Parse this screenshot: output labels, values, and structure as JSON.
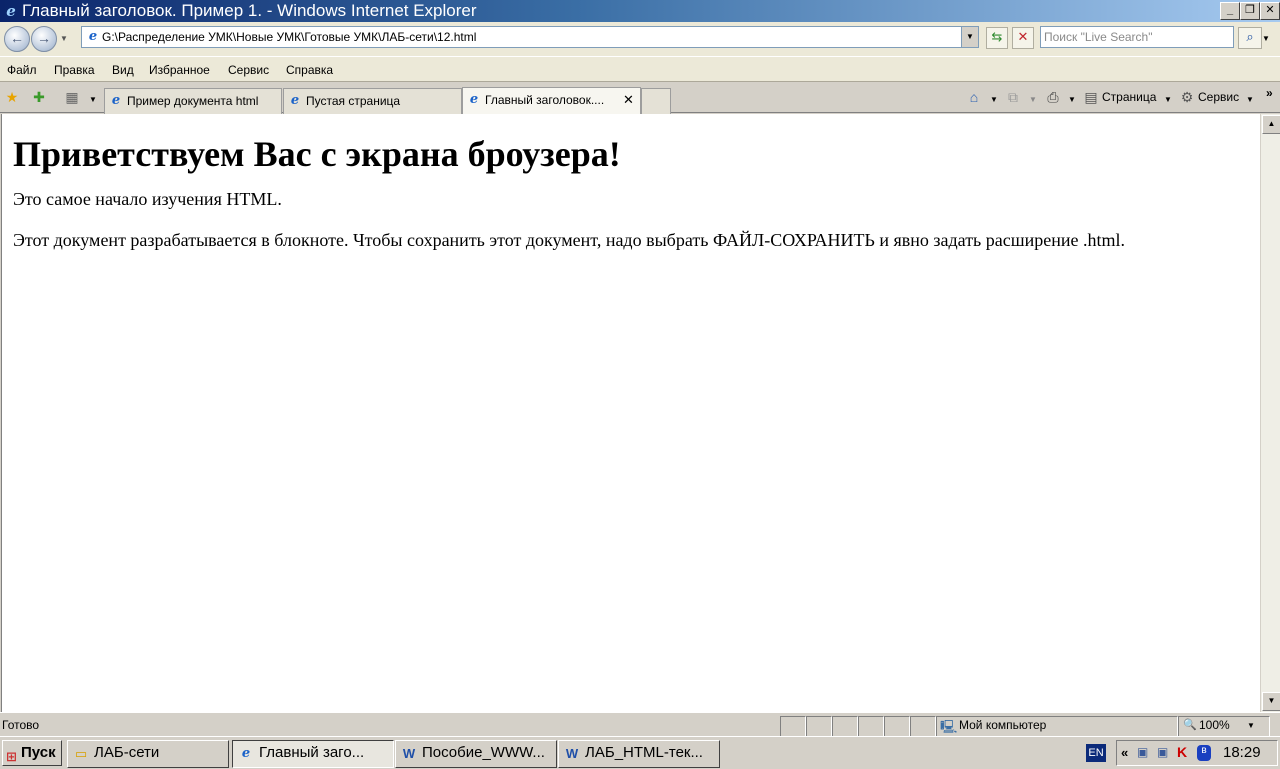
{
  "window": {
    "title": "Главный заголовок. Пример 1. - Windows Internet Explorer",
    "controls": [
      "_",
      "❐",
      "✕"
    ]
  },
  "address_bar": {
    "url": "G:\\Распределение УМК\\Новые УМК\\Готовые УМК\\ЛАБ-сети\\12.html",
    "search_placeholder": "Поиск \"Live Search\""
  },
  "menu": {
    "items": [
      "Файл",
      "Правка",
      "Вид",
      "Избранное",
      "Сервис",
      "Справка"
    ]
  },
  "tabs": [
    {
      "label": "Пример документа html",
      "active": false
    },
    {
      "label": "Пустая страница",
      "active": false
    },
    {
      "label": "Главный заголовок....",
      "active": true
    }
  ],
  "command_bar": {
    "page_label": "Страница",
    "tools_label": "Сервис"
  },
  "page": {
    "heading": "Приветствуем Вас с экрана броузера!",
    "paragraph1": "Это самое начало изучения HTML.",
    "paragraph2": "Этот документ разрабатывается в блокноте. Чтобы сохранить этот документ, надо выбрать ФАЙЛ-СОХРАНИТЬ и явно задать расширение .html."
  },
  "status_bar": {
    "status": "Готово",
    "zone": "Мой компьютер",
    "zoom": "100%"
  },
  "taskbar": {
    "start_label": "Пуск",
    "tasks": [
      {
        "label": "ЛАБ-сети",
        "active": false
      },
      {
        "label": "Главный заго...",
        "active": true
      },
      {
        "label": "Пособие_WWW...",
        "active": false
      },
      {
        "label": "ЛАБ_HTML-тек...",
        "active": false
      }
    ],
    "language": "EN",
    "clock": "18:29"
  }
}
